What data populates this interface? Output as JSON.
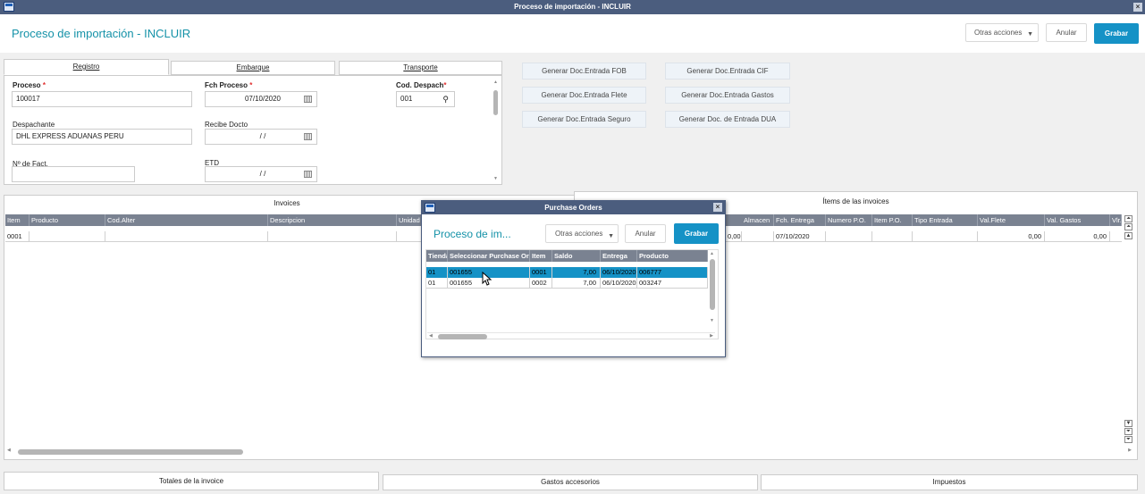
{
  "window": {
    "title": "Proceso de importación - INCLUIR"
  },
  "header": {
    "title": "Proceso de importación - INCLUIR",
    "more_actions": "Otras acciones",
    "cancel": "Anular",
    "save": "Grabar"
  },
  "tabs": [
    {
      "label": "Registro",
      "active": true
    },
    {
      "label": "Embarque",
      "active": false
    },
    {
      "label": "Transporte",
      "active": false
    }
  ],
  "form": {
    "proceso": {
      "label": "Proceso",
      "value": "100017"
    },
    "fch_proceso": {
      "label": "Fch Proceso",
      "value": "07/10/2020"
    },
    "cod_despach": {
      "label": "Cod. Despach",
      "value": "001"
    },
    "despachante": {
      "label": "Despachante",
      "value": "DHL EXPRESS ADUANAS PERU"
    },
    "recibe_docto": {
      "label": "Recibe Docto",
      "value": "/ /"
    },
    "nro_fact": {
      "label": "Nº de Fact.",
      "value": ""
    },
    "etd": {
      "label": "ETD",
      "value": "/ /"
    }
  },
  "generate_buttons": [
    "Generar Doc.Entrada FOB",
    "Generar Doc.Entrada CIF",
    "Generar Doc.Entrada Flete",
    "Generar Doc.Entrada Gastos",
    "Generar Doc.Entrada Seguro",
    "Generar Doc. de Entrada DUA"
  ],
  "invoices": {
    "title": "Invoices",
    "columns": [
      "Item",
      "Producto",
      "Cod.Alter",
      "Descripcion",
      "Unidad"
    ],
    "rows": [
      [
        "0001",
        "",
        "",
        "",
        ""
      ]
    ]
  },
  "items_invoices": {
    "title": "Ítems de las invoices",
    "columns": [
      "Almacen",
      "Fch. Entrega",
      "Numero P.O.",
      "Item P.O.",
      "Tipo Entrada",
      "Val.Flete",
      "Val. Gastos",
      "Vlr."
    ],
    "rows": [
      [
        "0,00",
        "",
        "07/10/2020",
        "",
        "",
        "",
        "0,00",
        "0,00"
      ]
    ]
  },
  "bottom_tabs": [
    "Totales de la invoice",
    "Gastos accesorios",
    "Impuestos"
  ],
  "dialog": {
    "title": "Purchase Orders",
    "page_title": "Proceso de im...",
    "more_actions": "Otras acciones",
    "cancel": "Anular",
    "save": "Grabar",
    "columns": [
      "Tienda",
      "Seleccionar Purchase Or",
      "Item",
      "Saldo",
      "Entrega",
      "Producto"
    ],
    "rows": [
      [
        "01",
        "001655",
        "0001",
        "7,00",
        "06/10/2020",
        "006777"
      ],
      [
        "01",
        "001655",
        "0002",
        "7,00",
        "06/10/2020",
        "003247"
      ]
    ]
  }
}
